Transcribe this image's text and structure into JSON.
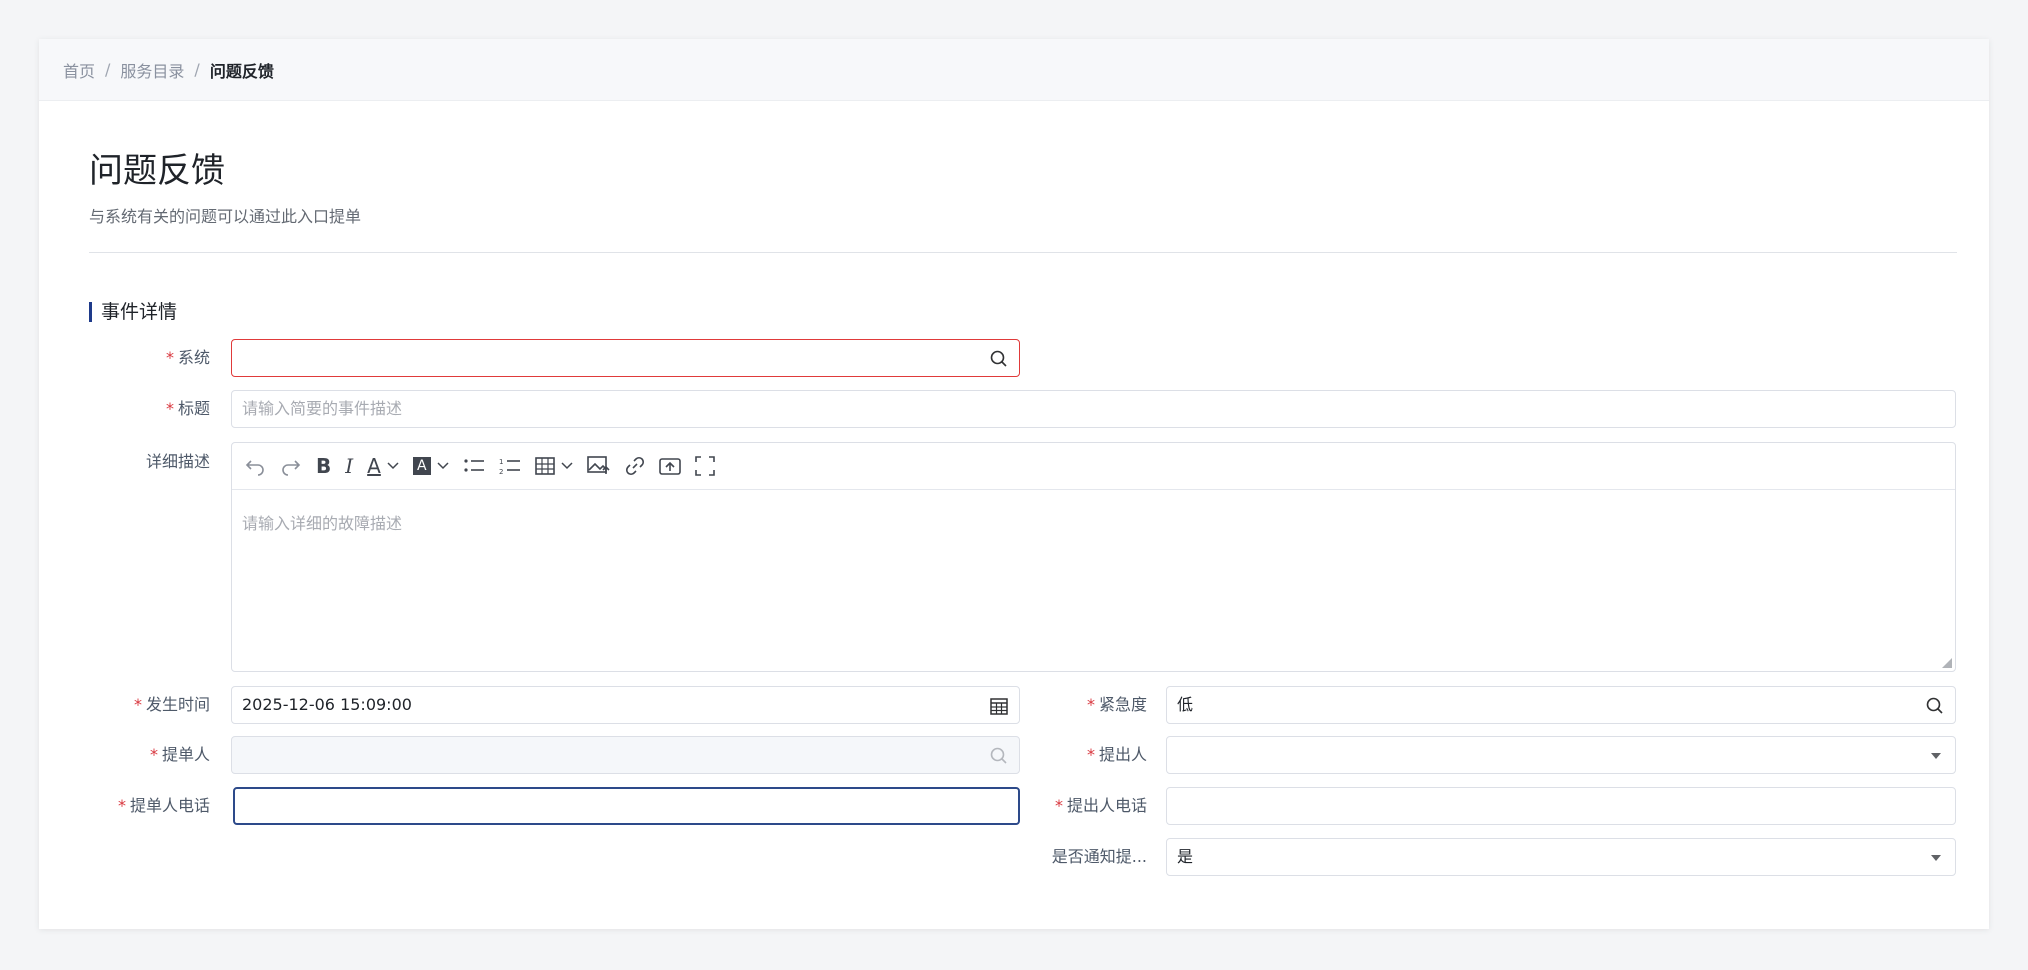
{
  "breadcrumb": [
    "首页",
    "服务目录",
    "问题反馈"
  ],
  "page": {
    "title": "问题反馈",
    "subtitle": "与系统有关的问题可以通过此入口提单"
  },
  "section": {
    "title": "事件详情"
  },
  "form": {
    "system": {
      "label": "系统",
      "value": ""
    },
    "title": {
      "label": "标题",
      "placeholder": "请输入简要的事件描述"
    },
    "detail": {
      "label": "详细描述",
      "placeholder": "请输入详细的故障描述"
    },
    "occur_time": {
      "label": "发生时间",
      "value": "2025-12-06 15:09:00"
    },
    "urgency": {
      "label": "紧急度",
      "value": "低"
    },
    "submitter": {
      "label": "提单人",
      "value": ""
    },
    "proposer": {
      "label": "提出人",
      "value": ""
    },
    "submitter_phone": {
      "label": "提单人电话",
      "value": ""
    },
    "proposer_phone": {
      "label": "提出人电话",
      "value": ""
    },
    "notify": {
      "label": "是否通知提...",
      "value": "是"
    }
  },
  "toolbar_icons": [
    "undo-icon",
    "redo-icon",
    "bold-icon",
    "italic-icon",
    "font-color-icon",
    "background-color-icon",
    "bullet-list-icon",
    "numbered-list-icon",
    "table-icon",
    "image-icon",
    "link-icon",
    "upload-icon",
    "fullscreen-icon"
  ],
  "colors": {
    "required": "#d9363e",
    "accent": "#1e3a8a",
    "error_border": "#e03a3a"
  }
}
